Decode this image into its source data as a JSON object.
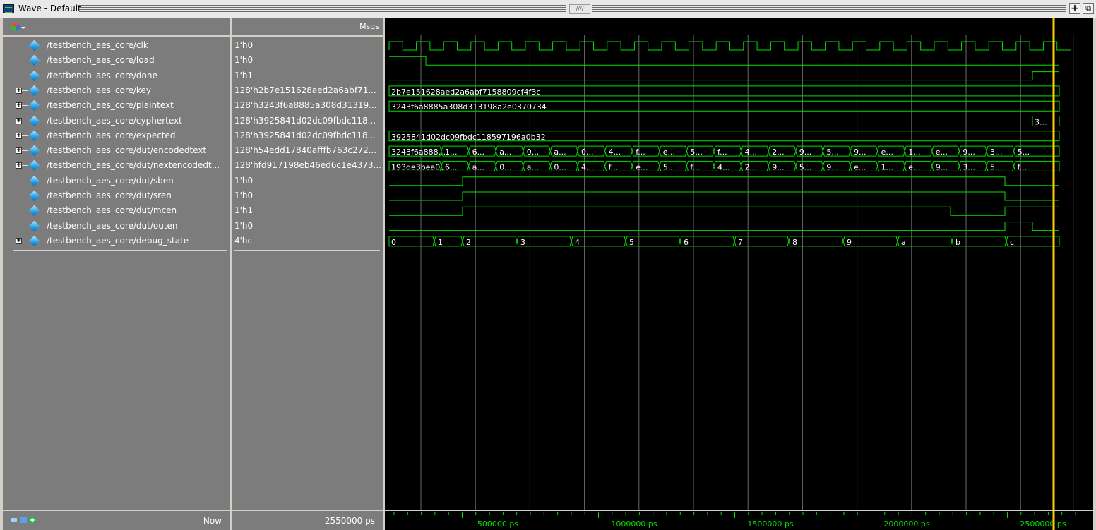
{
  "window": {
    "title": "Wave - Default"
  },
  "header": {
    "msgs_label": "Msgs"
  },
  "signals": [
    {
      "name": "/testbench_aes_core/clk",
      "value": "1'h0",
      "expandable": false
    },
    {
      "name": "/testbench_aes_core/load",
      "value": "1'h0",
      "expandable": false
    },
    {
      "name": "/testbench_aes_core/done",
      "value": "1'h1",
      "expandable": false
    },
    {
      "name": "/testbench_aes_core/key",
      "value": "128'h2b7e151628aed2a6abf71...",
      "expandable": true
    },
    {
      "name": "/testbench_aes_core/plaintext",
      "value": "128'h3243f6a8885a308d31319...",
      "expandable": true
    },
    {
      "name": "/testbench_aes_core/cyphertext",
      "value": "128'h3925841d02dc09fbdc118...",
      "expandable": true
    },
    {
      "name": "/testbench_aes_core/expected",
      "value": "128'h3925841d02dc09fbdc118...",
      "expandable": true
    },
    {
      "name": "/testbench_aes_core/dut/encodedtext",
      "value": "128'h54edd17840afffb763c272...",
      "expandable": true
    },
    {
      "name": "/testbench_aes_core/dut/nextencodedt...",
      "value": "128'hfd917198eb46ed6c1e4373...",
      "expandable": true
    },
    {
      "name": "/testbench_aes_core/dut/sben",
      "value": "1'h0",
      "expandable": false
    },
    {
      "name": "/testbench_aes_core/dut/sren",
      "value": "1'h0",
      "expandable": false
    },
    {
      "name": "/testbench_aes_core/dut/mcen",
      "value": "1'h1",
      "expandable": false
    },
    {
      "name": "/testbench_aes_core/dut/outen",
      "value": "1'h0",
      "expandable": false
    },
    {
      "name": "/testbench_aes_core/debug_state",
      "value": "4'hc",
      "expandable": true
    }
  ],
  "bus_text": {
    "key": "2b7e151628aed2a6abf7158809cf4f3c",
    "plaintext": "3243f6a8885a308d313198a2e0370734",
    "cyphertext_end": "3...",
    "expected": "3925841d02dc09fbdc118597196a0b32",
    "encodedtext": [
      "3243f6a888...",
      "1...",
      "6...",
      "a...",
      "0...",
      "a...",
      "0...",
      "4...",
      "f...",
      "e...",
      "5...",
      "f...",
      "4...",
      "2...",
      "9...",
      "5...",
      "9...",
      "e...",
      "1...",
      "e...",
      "9...",
      "3...",
      "5..."
    ],
    "nextencodedtext": [
      "193de3bea0...",
      "6...",
      "a...",
      "0...",
      "a...",
      "0...",
      "4...",
      "f...",
      "e...",
      "5...",
      "f...",
      "4...",
      "2...",
      "9...",
      "5...",
      "9...",
      "e...",
      "1...",
      "e...",
      "9...",
      "3...",
      "5...",
      "f..."
    ],
    "debug_state": [
      "0",
      "1",
      "2",
      "3",
      "4",
      "5",
      "6",
      "7",
      "8",
      "9",
      "a",
      "b",
      "c"
    ]
  },
  "status": {
    "now_label": "Now",
    "now_value": "2550000 ps"
  },
  "time_axis": {
    "labels": [
      "500000 ps",
      "1000000 ps",
      "1500000 ps",
      "2000000 ps",
      "2500000 ps"
    ],
    "cursor_time_ps": 2550000
  },
  "colors": {
    "wave": "#00e000",
    "bus_red": "#e00000",
    "cursor": "#ffd000",
    "grid": "#6a6a6a"
  },
  "icons": {
    "header": "waveform-add-icon",
    "bottom": "cursor-tools-icon",
    "expand": "plus-box-icon",
    "signal": "diamond-signal-icon"
  }
}
